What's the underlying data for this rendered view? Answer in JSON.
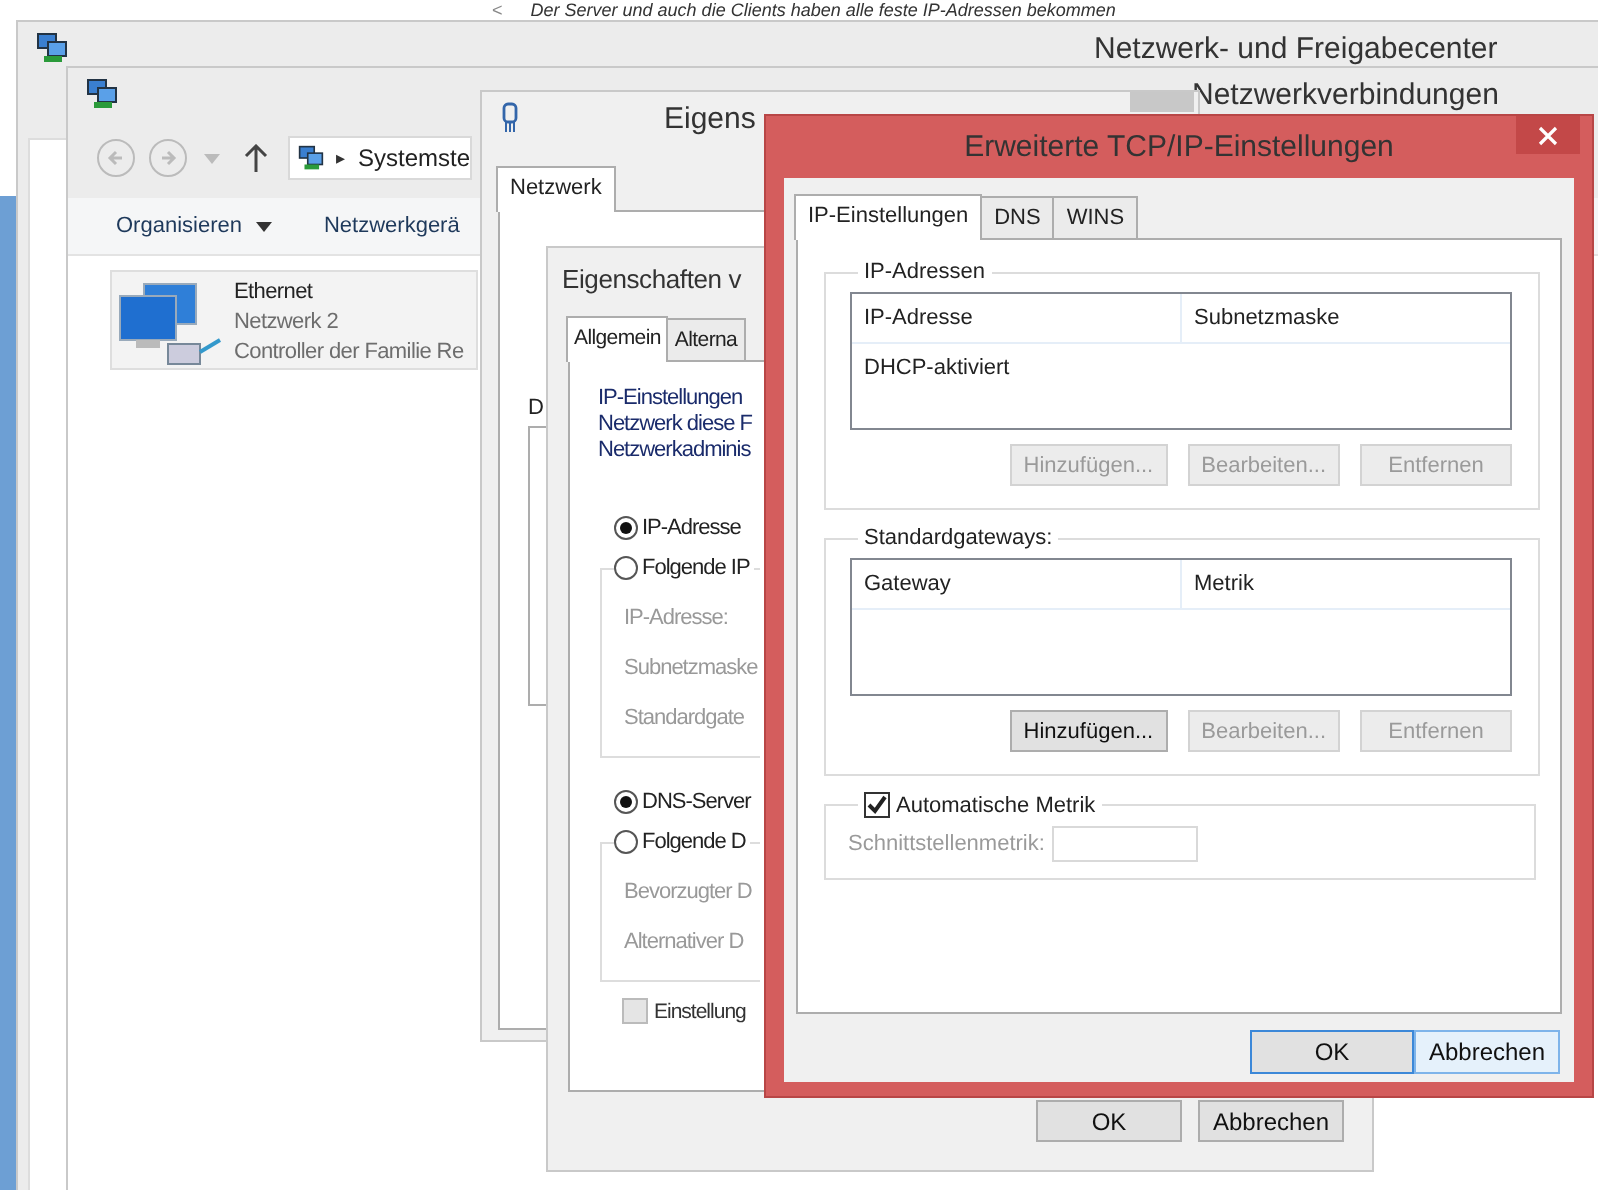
{
  "background_document": {
    "arrow": "<",
    "text": "Der Server und auch die Clients haben alle feste IP-Adressen bekommen"
  },
  "network_center": {
    "title": "Netzwerk- und Freigabecenter"
  },
  "connections": {
    "title": "Netzwerkverbindungen",
    "address": "Systemste",
    "address_separator": "▸",
    "toolbar": [
      {
        "label": "Organisieren",
        "dropdown": true
      },
      {
        "label": "Netzwerkgerä",
        "dropdown": false
      }
    ],
    "items": [
      {
        "name": "Ethernet",
        "status": "Netzwerk  2",
        "device": "Controller der Familie Re"
      }
    ]
  },
  "ethernet_properties": {
    "title": "Eigens",
    "tabs": [
      {
        "label": "Netzwerk",
        "selected": true
      }
    ],
    "fragment": "D"
  },
  "ipv4_properties": {
    "title": "Eigenschaften v",
    "tabs": [
      {
        "label": "Allgemein",
        "selected": true
      },
      {
        "label": "Alterna",
        "selected": false
      }
    ],
    "intro": [
      "IP-Einstellungen",
      "Netzwerk diese F",
      "Netzwerkadminis"
    ],
    "ip_mode": [
      {
        "label": "IP-Adresse",
        "selected": true
      },
      {
        "label": "Folgende IP",
        "selected": false
      }
    ],
    "ip_fields": [
      "IP-Adresse:",
      "Subnetzmaske",
      "Standardgate"
    ],
    "dns_mode": [
      {
        "label": "DNS-Server",
        "selected": true
      },
      {
        "label": "Folgende D",
        "selected": false
      }
    ],
    "dns_fields": [
      "Bevorzugter D",
      "Alternativer D"
    ],
    "validate": {
      "label": "Einstellung",
      "checked": false,
      "disabled": true
    },
    "buttons": [
      {
        "label": "OK"
      },
      {
        "label": "Abbrechen"
      }
    ]
  },
  "advanced_tcpip": {
    "title": "Erweiterte TCP/IP-Einstellungen",
    "tabs": [
      {
        "label": "IP-Einstellungen",
        "selected": true
      },
      {
        "label": "DNS",
        "selected": false
      },
      {
        "label": "WINS",
        "selected": false
      }
    ],
    "groups": [
      {
        "legend": "IP-Adressen",
        "columns": [
          "IP-Adresse",
          "Subnetzmaske"
        ],
        "rows": [
          [
            "DHCP-aktiviert"
          ]
        ],
        "buttons": [
          {
            "label": "Hinzufügen...",
            "disabled": true
          },
          {
            "label": "Bearbeiten...",
            "disabled": true
          },
          {
            "label": "Entfernen",
            "disabled": true
          }
        ]
      },
      {
        "legend": "Standardgateways:",
        "columns": [
          "Gateway",
          "Metrik"
        ],
        "buttons": [
          {
            "label": "Hinzufügen...",
            "disabled": false
          },
          {
            "label": "Bearbeiten...",
            "disabled": true
          },
          {
            "label": "Entfernen",
            "disabled": true
          }
        ]
      }
    ],
    "metric": {
      "label": "Automatische Metrik",
      "checked": true,
      "field_label": "Schnittstellenmetrik:",
      "field_disabled": true
    },
    "buttons": [
      {
        "label": "OK",
        "default": true,
        "hovered": false
      },
      {
        "label": "Abbrechen",
        "default": false,
        "hovered": true
      }
    ]
  }
}
